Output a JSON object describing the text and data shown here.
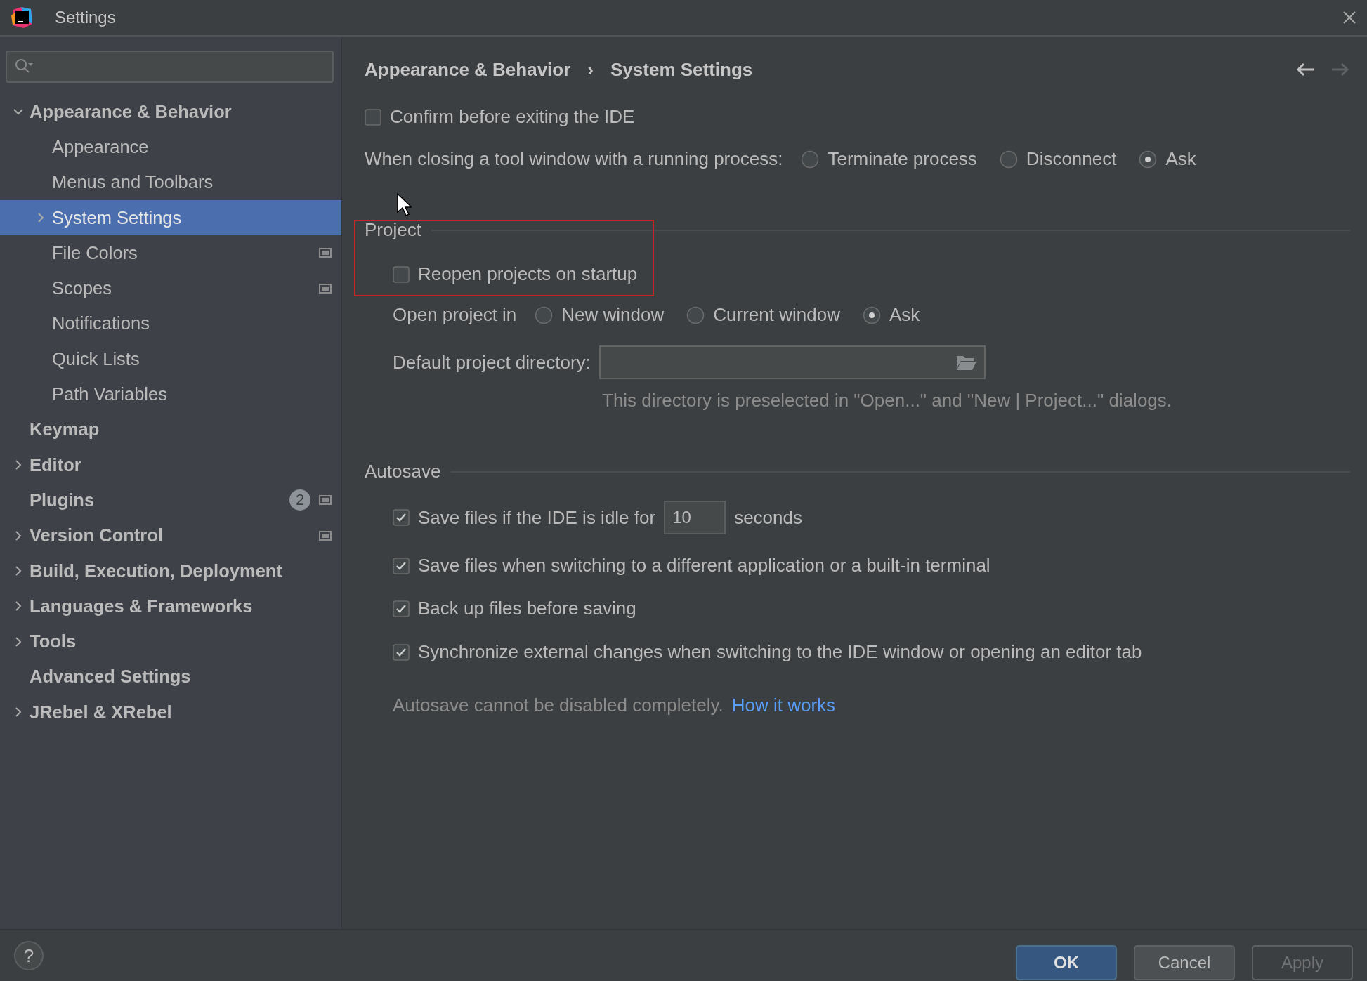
{
  "window": {
    "title": "Settings"
  },
  "sidebar": {
    "items": [
      {
        "label": "Appearance & Behavior",
        "expanded": true,
        "selected": false,
        "per_project": false,
        "children": [
          {
            "label": "Appearance",
            "selected": false,
            "per_project": false
          },
          {
            "label": "Menus and Toolbars",
            "selected": false,
            "per_project": false
          },
          {
            "label": "System Settings",
            "expanded": false,
            "selected": true,
            "per_project": false
          },
          {
            "label": "File Colors",
            "selected": false,
            "per_project": true
          },
          {
            "label": "Scopes",
            "selected": false,
            "per_project": true
          },
          {
            "label": "Notifications",
            "selected": false,
            "per_project": false
          },
          {
            "label": "Quick Lists",
            "selected": false,
            "per_project": false
          },
          {
            "label": "Path Variables",
            "selected": false,
            "per_project": false
          }
        ]
      },
      {
        "label": "Keymap",
        "selected": false,
        "per_project": false
      },
      {
        "label": "Editor",
        "expanded": false,
        "selected": false,
        "per_project": false
      },
      {
        "label": "Plugins",
        "selected": false,
        "per_project": true,
        "badge": "2"
      },
      {
        "label": "Version Control",
        "expanded": false,
        "selected": false,
        "per_project": true
      },
      {
        "label": "Build, Execution, Deployment",
        "expanded": false,
        "selected": false,
        "per_project": false
      },
      {
        "label": "Languages & Frameworks",
        "expanded": false,
        "selected": false,
        "per_project": false
      },
      {
        "label": "Tools",
        "expanded": false,
        "selected": false,
        "per_project": false
      },
      {
        "label": "Advanced Settings",
        "selected": false,
        "per_project": false
      },
      {
        "label": "JRebel & XRebel",
        "expanded": false,
        "selected": false,
        "per_project": false
      }
    ]
  },
  "breadcrumb": [
    "Appearance & Behavior",
    "›",
    "System Settings"
  ],
  "nav": {
    "back_enabled": true,
    "forward_enabled": false
  },
  "general": [
    {
      "kind": "checkbox",
      "label": "Confirm before exiting the IDE",
      "checked": false
    },
    {
      "kind": "radio",
      "label": "When closing a tool window with a running process:",
      "options": [
        {
          "label": "Terminate process",
          "selected": false
        },
        {
          "label": "Disconnect",
          "selected": false
        },
        {
          "label": "Ask",
          "selected": true
        }
      ]
    }
  ],
  "project": {
    "title": "Project",
    "rows": [
      {
        "kind": "checkbox",
        "label": "Reopen projects on startup",
        "checked": false,
        "highlighted": true
      },
      {
        "kind": "radio",
        "label": "Open project in",
        "options": [
          {
            "label": "New window",
            "selected": false
          },
          {
            "label": "Current window",
            "selected": false
          },
          {
            "label": "Ask",
            "selected": true
          }
        ]
      },
      {
        "kind": "path",
        "label": "Default project directory:",
        "value": "",
        "hint": "This directory is preselected in \"Open...\" and \"New | Project...\" dialogs."
      }
    ]
  },
  "autosave": {
    "title": "Autosave",
    "rows": [
      {
        "kind": "idle",
        "label": "Save files if the IDE is idle for",
        "checked": true,
        "value": "10",
        "unit": "seconds"
      },
      {
        "kind": "checkbox",
        "label": "Save files when switching to a different application or a built-in terminal",
        "checked": true
      },
      {
        "kind": "checkbox",
        "label": "Back up files before saving",
        "checked": true
      },
      {
        "kind": "checkbox",
        "label": "Synchronize external changes when switching to the IDE window or opening an editor tab",
        "checked": true
      }
    ],
    "note": "Autosave cannot be disabled completely.",
    "link": "How it works"
  },
  "buttons": [
    {
      "label": "OK",
      "kind": "primary",
      "disabled": false
    },
    {
      "label": "Cancel",
      "kind": "normal",
      "disabled": false
    },
    {
      "label": "Apply",
      "kind": "normal",
      "disabled": true
    }
  ],
  "help": "?"
}
